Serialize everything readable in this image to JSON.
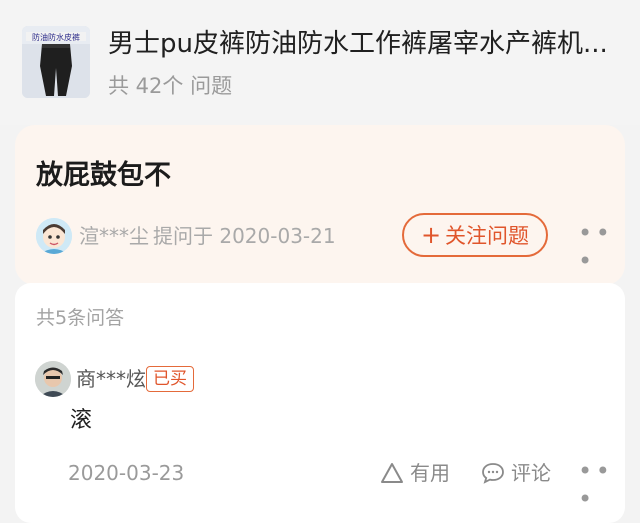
{
  "product": {
    "title": "男士pu皮裤防油防水工作裤屠宰水产裤机...",
    "question_count": "共 42个 问题",
    "thumb_text": "防油防水皮裤"
  },
  "question": {
    "title": "放屁鼓包不",
    "asker": "渲***尘",
    "asked_on": "提问于 2020-03-21",
    "follow_label": "关注问题"
  },
  "answers": {
    "count_label": "共5条问答",
    "items": [
      {
        "user": "商***炫",
        "badge": "已买",
        "text": "滚",
        "date": "2020-03-23",
        "useful_label": "有用",
        "comment_label": "评论"
      }
    ]
  },
  "colors": {
    "accent": "#e46a3a",
    "card_tint": "#fdf5ef"
  }
}
